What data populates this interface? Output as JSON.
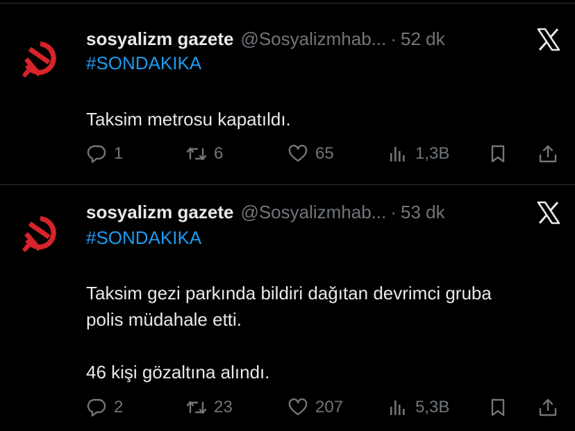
{
  "tweets": [
    {
      "author_name": "sosyalizm gazete",
      "handle": "@Sosyalizmhab...",
      "separator": "·",
      "time": "52 dk",
      "hashtag": "#SONDAKIKA",
      "body_lines": [
        "Taksim metrosu kapatıldı."
      ],
      "replies": "1",
      "retweets": "6",
      "likes": "65",
      "views": "1,3B"
    },
    {
      "author_name": "sosyalizm gazete",
      "handle": "@Sosyalizmhab...",
      "separator": "·",
      "time": "53 dk",
      "hashtag": "#SONDAKIKA",
      "body_lines": [
        "Taksim gezi parkında bildiri dağıtan devrimci gruba",
        "polis müdahale etti.",
        "46 kişi gözaltına alındı."
      ],
      "replies": "2",
      "retweets": "23",
      "likes": "207",
      "views": "5,3B"
    }
  ],
  "icons": {
    "avatar": "hammer-and-sickle-icon",
    "platform_logo": "x-logo-icon",
    "reply": "reply-icon",
    "retweet": "retweet-icon",
    "like": "heart-icon",
    "views": "views-icon",
    "bookmark": "bookmark-icon",
    "share": "share-icon"
  },
  "colors": {
    "background": "#000000",
    "text": "#e7e9ea",
    "muted": "#71767b",
    "hashtag": "#1d9bf0",
    "avatar_symbol": "#d8232a",
    "divider": "#2f3336"
  }
}
